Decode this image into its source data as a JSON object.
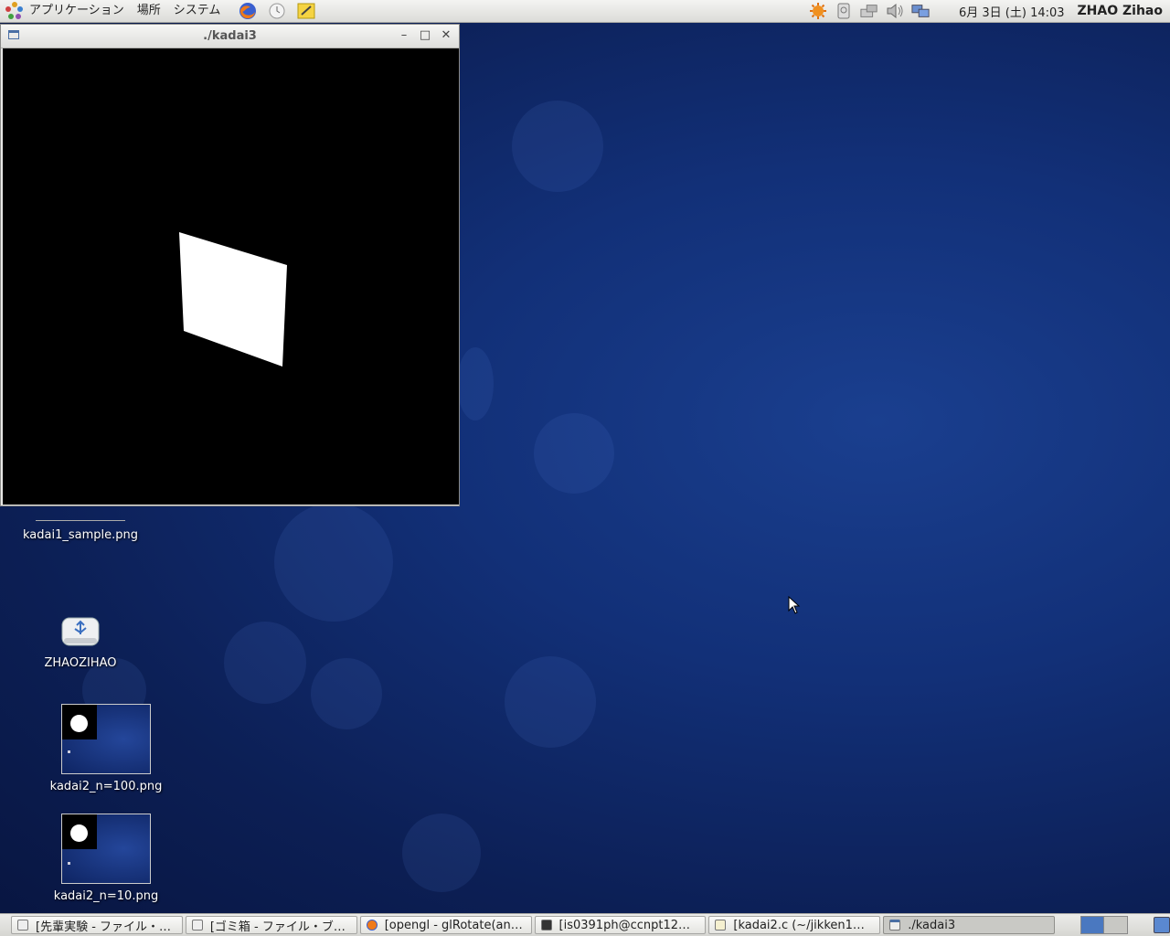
{
  "top_panel": {
    "menus": [
      "アプリケーション",
      "場所",
      "システム"
    ],
    "clock": "6月 3日 (土) 14:03",
    "user": "ZHAO Zihao"
  },
  "window": {
    "title": "./kadai3",
    "min_glyph": "–",
    "max_glyph": "□",
    "close_glyph": "✕"
  },
  "desktop": {
    "icons": [
      {
        "label": "kadai1_sample.png"
      },
      {
        "label": "ZHAOZIHAO"
      },
      {
        "label": "kadai2_n=100.png"
      },
      {
        "label": "kadai2_n=10.png"
      }
    ]
  },
  "taskbar": {
    "items": [
      {
        "label": "[先輩実験 - ファイル・…",
        "icon": "file-manager-icon"
      },
      {
        "label": "[ゴミ箱 - ファイル・ブ…",
        "icon": "file-manager-icon"
      },
      {
        "label": "[opengl - glRotate(an…",
        "icon": "firefox-icon"
      },
      {
        "label": "[is0391ph@ccnpt12…",
        "icon": "terminal-icon"
      },
      {
        "label": "[kadai2.c (~/jikken1…",
        "icon": "text-editor-icon"
      },
      {
        "label": "./kadai3",
        "icon": "window-icon",
        "active": true
      }
    ]
  },
  "colors": {
    "canvas": "#000000",
    "shape": "#ffffff",
    "desktop": "#123078"
  }
}
